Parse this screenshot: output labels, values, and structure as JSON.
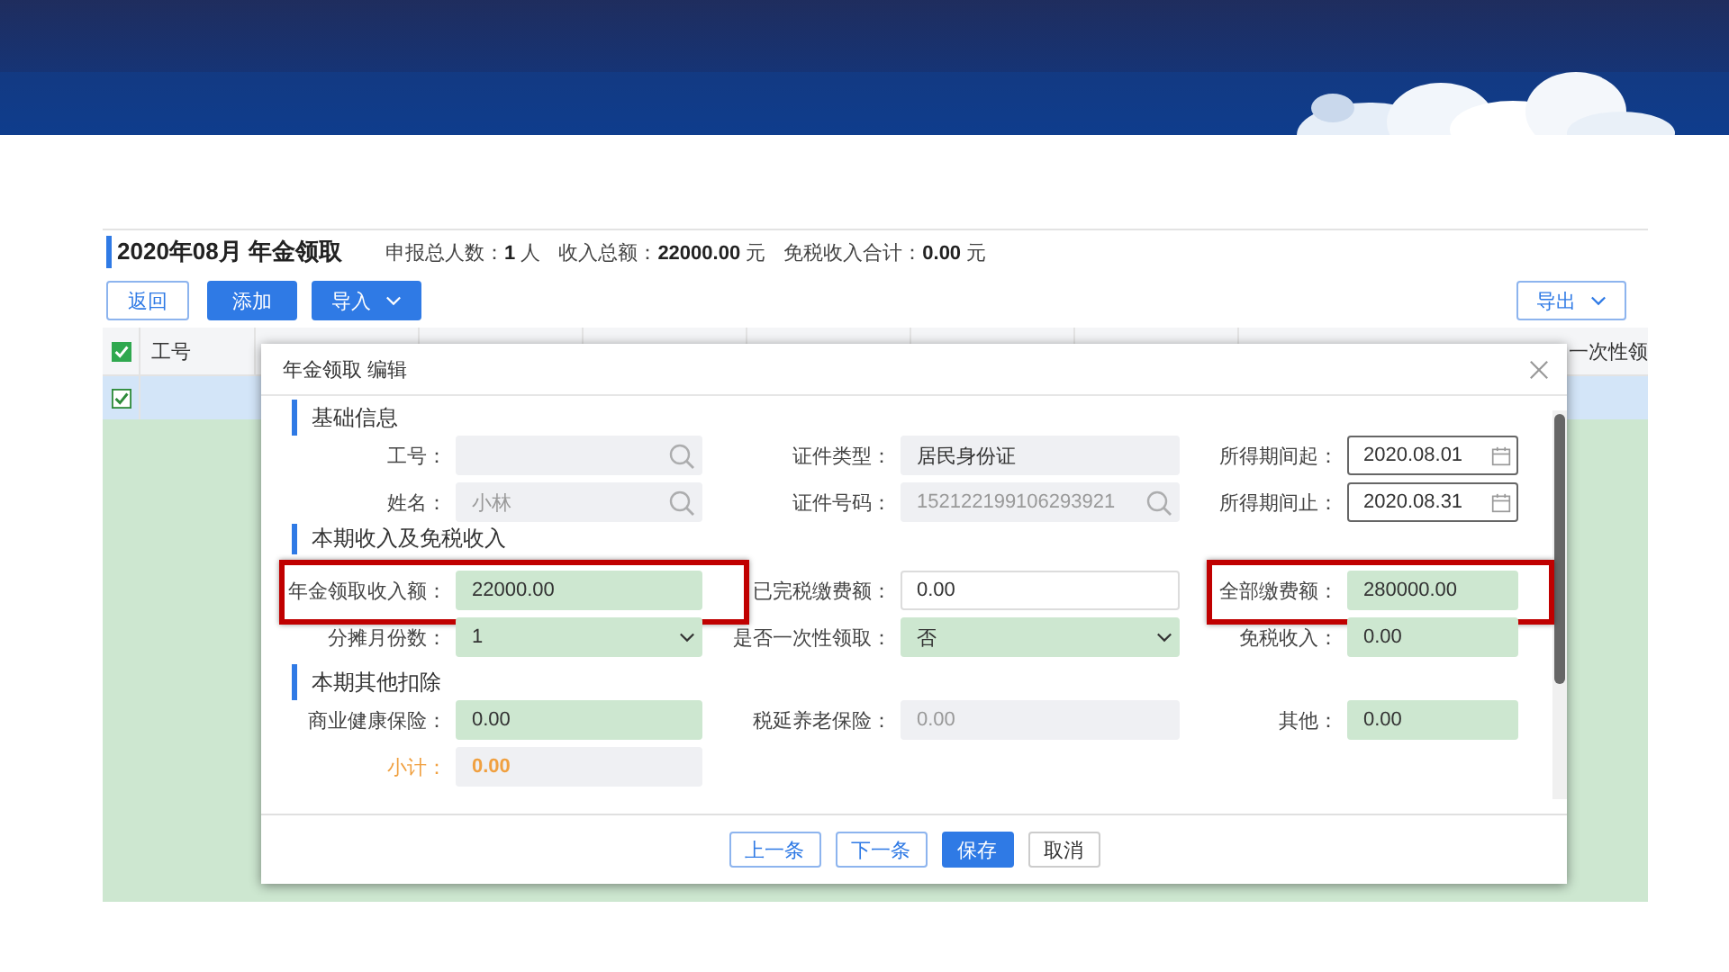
{
  "page": {
    "title": "2020年08月 年金领取",
    "summary": [
      "申报总人数：**1** 人",
      "收入总额：**22000.00** 元",
      "免税收入合计：**0.00** 元"
    ]
  },
  "toolbar": {
    "left": [
      {
        "label": "返回",
        "kind": "outline"
      },
      {
        "label": "添加",
        "kind": "primary"
      },
      {
        "label": "导入",
        "kind": "primary-dropdown"
      }
    ],
    "right": [
      {
        "label": "导出",
        "kind": "outline-dropdown"
      }
    ]
  },
  "table": {
    "all_checked": true,
    "columns": [
      {
        "label": "工号"
      },
      {
        "label": "一次性领"
      }
    ],
    "rows": [
      {
        "checked": true,
        "selected": true
      }
    ]
  },
  "dialog": {
    "title": "年金领取 编辑",
    "sections": [
      {
        "title": "基础信息",
        "rows": [
          [
            {
              "label": "工号：",
              "kind": "lookup",
              "color": "#eff0f3",
              "disabled": true,
              "emphasis": false,
              "highlighted": false
            },
            {
              "label": "证件类型：",
              "value": "居民身份证",
              "kind": "text",
              "color": "#eff0f3",
              "disabled": false,
              "emphasis": false,
              "highlighted": false
            },
            {
              "label": "所得期间起：",
              "value": "2020.08.01",
              "kind": "date",
              "color": "#ffffff",
              "disabled": false,
              "emphasis": false,
              "highlighted": false
            }
          ],
          [
            {
              "label": "姓名：",
              "value": "小林",
              "kind": "lookup",
              "color": "#eff0f3",
              "disabled": true,
              "emphasis": false,
              "highlighted": false
            },
            {
              "label": "证件号码：",
              "value": "152122199106293921",
              "kind": "lookup",
              "color": "#eff0f3",
              "disabled": true,
              "emphasis": false,
              "highlighted": false
            },
            {
              "label": "所得期间止：",
              "value": "2020.08.31",
              "kind": "date",
              "color": "#ffffff",
              "disabled": false,
              "emphasis": false,
              "highlighted": false
            }
          ]
        ]
      },
      {
        "title": "本期收入及免税收入",
        "rows": [
          [
            {
              "label": "年金领取收入额：",
              "value": "22000.00",
              "kind": "text",
              "color": "#cde7d0",
              "disabled": false,
              "emphasis": false,
              "highlighted": true
            },
            {
              "label": "已完税缴费额：",
              "value": "0.00",
              "kind": "text",
              "color": "#ffffff",
              "disabled": false,
              "emphasis": false,
              "highlighted": false
            },
            {
              "label": "全部缴费额：",
              "value": "280000.00",
              "kind": "text",
              "color": "#cde7d0",
              "disabled": false,
              "emphasis": false,
              "highlighted": true
            }
          ],
          [
            {
              "label": "分摊月份数：",
              "value": "1",
              "kind": "select",
              "color": "#cde7d0",
              "disabled": false,
              "emphasis": false,
              "highlighted": false
            },
            {
              "label": "是否一次性领取：",
              "value": "否",
              "kind": "select",
              "color": "#cde7d0",
              "disabled": false,
              "emphasis": false,
              "highlighted": false
            },
            {
              "label": "免税收入：",
              "value": "0.00",
              "kind": "text",
              "color": "#cde7d0",
              "disabled": false,
              "emphasis": false,
              "highlighted": false
            }
          ]
        ]
      },
      {
        "title": "本期其他扣除",
        "rows": [
          [
            {
              "label": "商业健康保险：",
              "value": "0.00",
              "kind": "text",
              "color": "#cde7d0",
              "disabled": false,
              "emphasis": false,
              "highlighted": false
            },
            {
              "label": "税延养老保险：",
              "value": "0.00",
              "kind": "text",
              "color": "#eff0f3",
              "disabled": true,
              "emphasis": false,
              "highlighted": false
            },
            {
              "label": "其他：",
              "value": "0.00",
              "kind": "text",
              "color": "#cde7d0",
              "disabled": false,
              "emphasis": false,
              "highlighted": false
            }
          ],
          [
            {
              "label": "小计：",
              "value": "0.00",
              "kind": "text",
              "color": "#eff0f3",
              "disabled": false,
              "emphasis": true,
              "highlighted": false
            }
          ]
        ]
      }
    ],
    "buttons": [
      {
        "label": "上一条",
        "kind": "outline"
      },
      {
        "label": "下一条",
        "kind": "outline"
      },
      {
        "label": "保存",
        "kind": "primary"
      },
      {
        "label": "取消",
        "kind": "plain"
      }
    ]
  }
}
